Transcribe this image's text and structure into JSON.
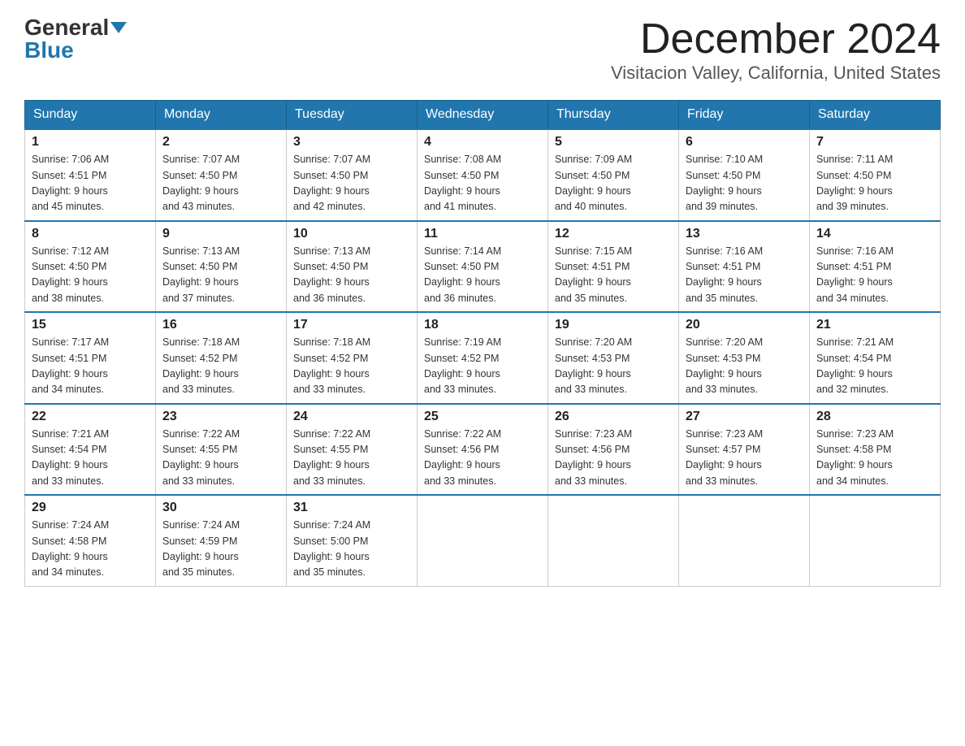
{
  "header": {
    "logo_general": "General",
    "logo_blue": "Blue",
    "month_title": "December 2024",
    "location": "Visitacion Valley, California, United States"
  },
  "days_of_week": [
    "Sunday",
    "Monday",
    "Tuesday",
    "Wednesday",
    "Thursday",
    "Friday",
    "Saturday"
  ],
  "weeks": [
    [
      {
        "day": "1",
        "sunrise": "7:06 AM",
        "sunset": "4:51 PM",
        "daylight": "9 hours and 45 minutes."
      },
      {
        "day": "2",
        "sunrise": "7:07 AM",
        "sunset": "4:50 PM",
        "daylight": "9 hours and 43 minutes."
      },
      {
        "day": "3",
        "sunrise": "7:07 AM",
        "sunset": "4:50 PM",
        "daylight": "9 hours and 42 minutes."
      },
      {
        "day": "4",
        "sunrise": "7:08 AM",
        "sunset": "4:50 PM",
        "daylight": "9 hours and 41 minutes."
      },
      {
        "day": "5",
        "sunrise": "7:09 AM",
        "sunset": "4:50 PM",
        "daylight": "9 hours and 40 minutes."
      },
      {
        "day": "6",
        "sunrise": "7:10 AM",
        "sunset": "4:50 PM",
        "daylight": "9 hours and 39 minutes."
      },
      {
        "day": "7",
        "sunrise": "7:11 AM",
        "sunset": "4:50 PM",
        "daylight": "9 hours and 39 minutes."
      }
    ],
    [
      {
        "day": "8",
        "sunrise": "7:12 AM",
        "sunset": "4:50 PM",
        "daylight": "9 hours and 38 minutes."
      },
      {
        "day": "9",
        "sunrise": "7:13 AM",
        "sunset": "4:50 PM",
        "daylight": "9 hours and 37 minutes."
      },
      {
        "day": "10",
        "sunrise": "7:13 AM",
        "sunset": "4:50 PM",
        "daylight": "9 hours and 36 minutes."
      },
      {
        "day": "11",
        "sunrise": "7:14 AM",
        "sunset": "4:50 PM",
        "daylight": "9 hours and 36 minutes."
      },
      {
        "day": "12",
        "sunrise": "7:15 AM",
        "sunset": "4:51 PM",
        "daylight": "9 hours and 35 minutes."
      },
      {
        "day": "13",
        "sunrise": "7:16 AM",
        "sunset": "4:51 PM",
        "daylight": "9 hours and 35 minutes."
      },
      {
        "day": "14",
        "sunrise": "7:16 AM",
        "sunset": "4:51 PM",
        "daylight": "9 hours and 34 minutes."
      }
    ],
    [
      {
        "day": "15",
        "sunrise": "7:17 AM",
        "sunset": "4:51 PM",
        "daylight": "9 hours and 34 minutes."
      },
      {
        "day": "16",
        "sunrise": "7:18 AM",
        "sunset": "4:52 PM",
        "daylight": "9 hours and 33 minutes."
      },
      {
        "day": "17",
        "sunrise": "7:18 AM",
        "sunset": "4:52 PM",
        "daylight": "9 hours and 33 minutes."
      },
      {
        "day": "18",
        "sunrise": "7:19 AM",
        "sunset": "4:52 PM",
        "daylight": "9 hours and 33 minutes."
      },
      {
        "day": "19",
        "sunrise": "7:20 AM",
        "sunset": "4:53 PM",
        "daylight": "9 hours and 33 minutes."
      },
      {
        "day": "20",
        "sunrise": "7:20 AM",
        "sunset": "4:53 PM",
        "daylight": "9 hours and 33 minutes."
      },
      {
        "day": "21",
        "sunrise": "7:21 AM",
        "sunset": "4:54 PM",
        "daylight": "9 hours and 32 minutes."
      }
    ],
    [
      {
        "day": "22",
        "sunrise": "7:21 AM",
        "sunset": "4:54 PM",
        "daylight": "9 hours and 33 minutes."
      },
      {
        "day": "23",
        "sunrise": "7:22 AM",
        "sunset": "4:55 PM",
        "daylight": "9 hours and 33 minutes."
      },
      {
        "day": "24",
        "sunrise": "7:22 AM",
        "sunset": "4:55 PM",
        "daylight": "9 hours and 33 minutes."
      },
      {
        "day": "25",
        "sunrise": "7:22 AM",
        "sunset": "4:56 PM",
        "daylight": "9 hours and 33 minutes."
      },
      {
        "day": "26",
        "sunrise": "7:23 AM",
        "sunset": "4:56 PM",
        "daylight": "9 hours and 33 minutes."
      },
      {
        "day": "27",
        "sunrise": "7:23 AM",
        "sunset": "4:57 PM",
        "daylight": "9 hours and 33 minutes."
      },
      {
        "day": "28",
        "sunrise": "7:23 AM",
        "sunset": "4:58 PM",
        "daylight": "9 hours and 34 minutes."
      }
    ],
    [
      {
        "day": "29",
        "sunrise": "7:24 AM",
        "sunset": "4:58 PM",
        "daylight": "9 hours and 34 minutes."
      },
      {
        "day": "30",
        "sunrise": "7:24 AM",
        "sunset": "4:59 PM",
        "daylight": "9 hours and 35 minutes."
      },
      {
        "day": "31",
        "sunrise": "7:24 AM",
        "sunset": "5:00 PM",
        "daylight": "9 hours and 35 minutes."
      },
      null,
      null,
      null,
      null
    ]
  ],
  "labels": {
    "sunrise": "Sunrise:",
    "sunset": "Sunset:",
    "daylight": "Daylight:"
  }
}
